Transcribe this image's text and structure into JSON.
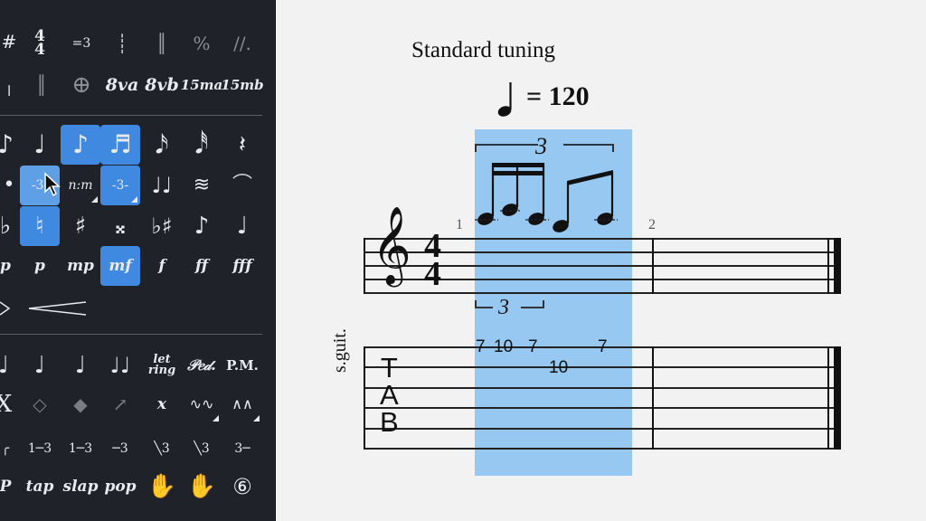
{
  "palette": {
    "row1": [
      "#",
      "4\n4",
      "=3",
      "┊",
      "║",
      "%",
      "//."
    ],
    "row2": [
      "╷",
      "║",
      "⊕",
      "8va",
      "8vb",
      "15ma",
      "15mb"
    ],
    "notes": [
      "♪",
      "♩",
      "♪",
      "♬",
      "𝅘𝅥𝅯",
      "𝅘𝅥𝅰",
      "𝄽"
    ],
    "tuplets": [
      "•",
      "-3-",
      "n:m",
      "-3-",
      "♩♩",
      "≋",
      "⌒"
    ],
    "accidentals": [
      "♭",
      "♮",
      "♯",
      "𝄪",
      "♭♯",
      "♪",
      "♩"
    ],
    "dynamics": [
      "p",
      "p",
      "mp",
      "mf",
      "f",
      "ff",
      "fff"
    ],
    "techniques": [
      "♩",
      "♩",
      "♩",
      "♩♩",
      "let ring",
      "𝒫𝑒𝒹.",
      "P.M."
    ],
    "marks2": [
      "X",
      "◇",
      "◆",
      "↗",
      "x",
      "∿∿",
      "∧∧"
    ],
    "slides": [
      "╭",
      "1─3",
      "1─3",
      "─3",
      "╲3",
      "╲3",
      "3─"
    ],
    "tech2": [
      "P",
      "tap",
      "slap",
      "pop",
      "✋",
      "✋",
      "⑥"
    ]
  },
  "score": {
    "tuning": "Standard tuning",
    "tempo_value": "= 120",
    "tuplet_upper": "3",
    "tuplet_lower": "3",
    "measure1": "1",
    "measure2": "2",
    "time_sig_top": "4",
    "time_sig_bottom": "4",
    "instrument": "s.guit.",
    "tab_letters": [
      "T",
      "A",
      "B"
    ],
    "tab_numbers": [
      "7",
      "10",
      "7",
      "10",
      "7"
    ]
  },
  "colors": {
    "palette_bg": "#1f2229",
    "selection": "#3f8ae0",
    "score_selection": "#8cc6f2"
  }
}
